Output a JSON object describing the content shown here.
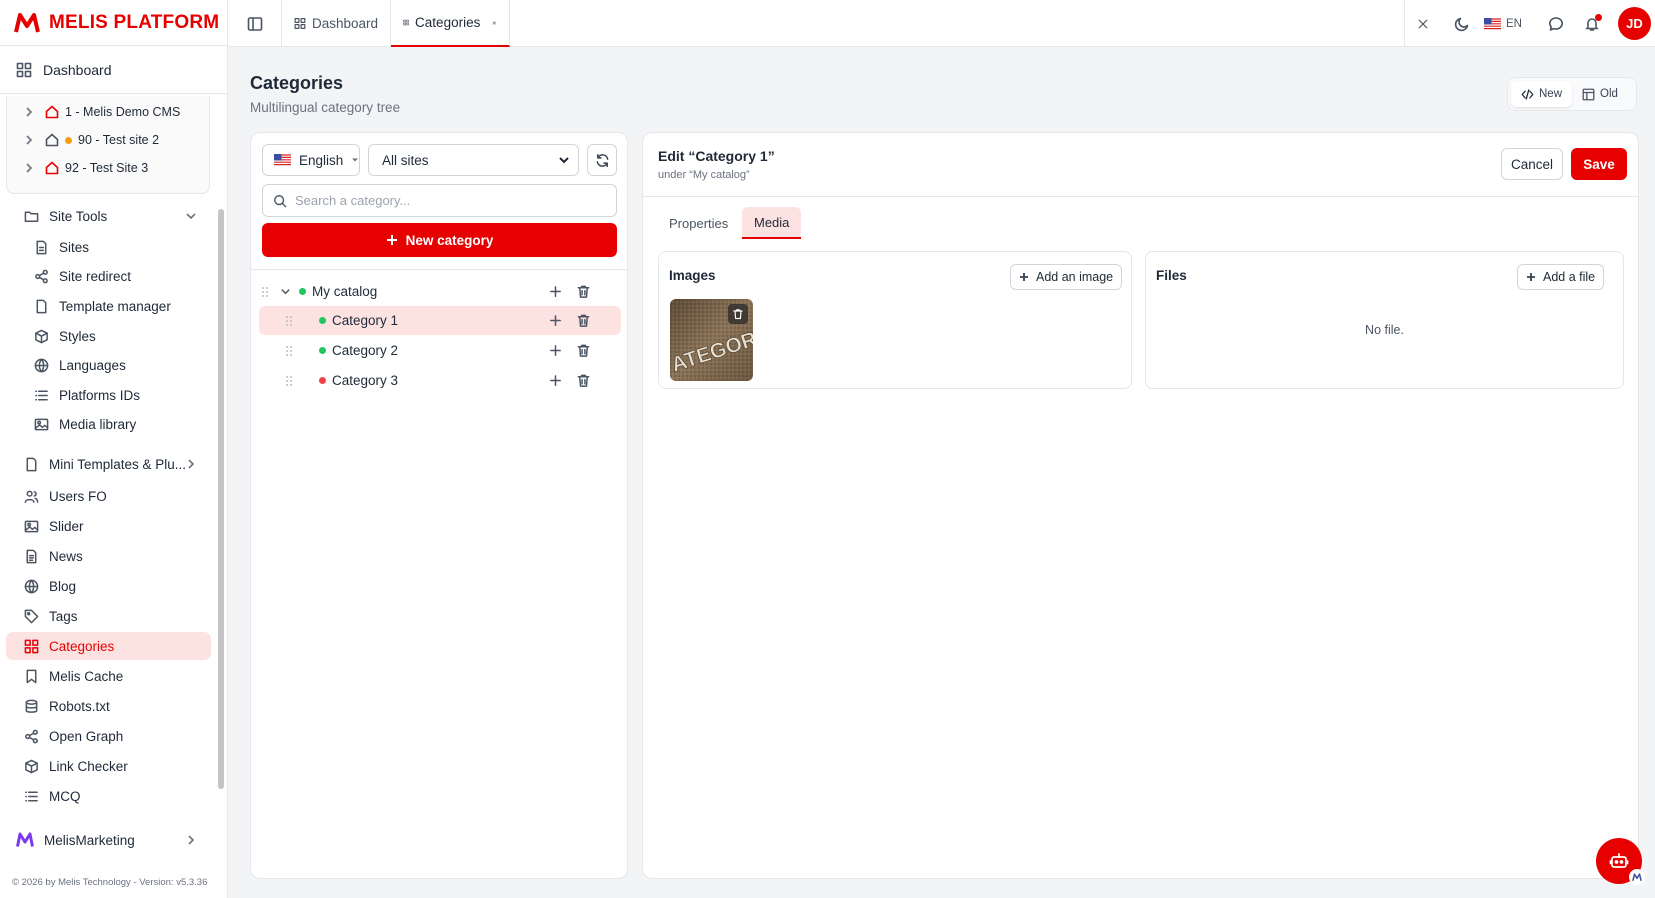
{
  "brand": {
    "name": "MELIS PLATFORM"
  },
  "sidebar": {
    "dashboard": "Dashboard",
    "sites": [
      {
        "label": "1 - Melis Demo CMS",
        "status": "none"
      },
      {
        "label": "90 - Test site 2",
        "status": "orange"
      },
      {
        "label": "92 - Test Site 3",
        "status": "none"
      }
    ],
    "site_tools": "Site Tools",
    "site_tools_items": [
      "Sites",
      "Site redirect",
      "Template manager",
      "Styles",
      "Languages",
      "Platforms IDs",
      "Media library"
    ],
    "items": [
      "Mini Templates & Plu...",
      "Users FO",
      "Slider",
      "News",
      "Blog",
      "Tags",
      "Categories",
      "Melis Cache",
      "Robots.txt",
      "Open Graph",
      "Link Checker",
      "MCQ"
    ],
    "active": "Categories",
    "marketing": "MelisMarketing",
    "footer": "© 2026 by Melis Technology - Version: v5.3.36"
  },
  "topbar": {
    "tabs": [
      "Dashboard",
      "Categories"
    ],
    "lang": "EN",
    "avatar": "JD"
  },
  "page": {
    "title": "Categories",
    "subtitle": "Multilingual category tree",
    "view_new": "New",
    "view_old": "Old"
  },
  "tree": {
    "language": "English",
    "site_filter": "All sites",
    "search_placeholder": "Search a category...",
    "new_button": "New category",
    "nodes": [
      {
        "label": "My catalog",
        "status": "green"
      },
      {
        "label": "Category 1",
        "status": "green"
      },
      {
        "label": "Category 2",
        "status": "green"
      },
      {
        "label": "Category 3",
        "status": "red"
      }
    ]
  },
  "edit": {
    "title": "Edit “Category 1”",
    "subtitle": "under “My catalog”",
    "cancel": "Cancel",
    "save": "Save",
    "tabs": [
      "Properties",
      "Media"
    ],
    "images_title": "Images",
    "add_image": "Add an image",
    "thumb_text": "ATEGOR",
    "files_title": "Files",
    "add_file": "Add a file",
    "no_file": "No file."
  },
  "colors": {
    "accent": "#e60000",
    "active_bg": "#fde2e2",
    "green": "#22c55e",
    "red": "#ef4444",
    "orange": "#f59e0b"
  }
}
